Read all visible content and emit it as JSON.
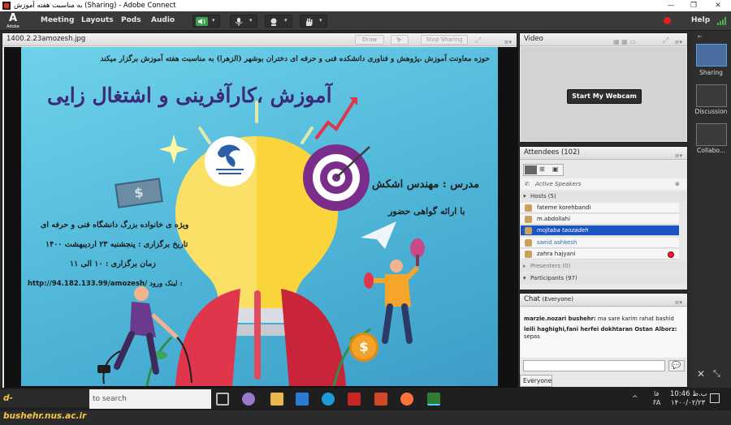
{
  "window": {
    "title": "به مناسبت هفته آموزش (Sharing) - Adobe Connect",
    "minimize": "—",
    "maximize": "❐",
    "close": "✕"
  },
  "menubar": {
    "logo_text": "Adobe",
    "items": [
      "Meeting",
      "Layouts",
      "Pods",
      "Audio"
    ],
    "help": "Help",
    "record_color": "#e02020"
  },
  "share_pod": {
    "title": "1400.2.23amozesh.jpg",
    "draw_label": "Draw",
    "stop_label": "Stop Sharing"
  },
  "slide": {
    "header": "حوزه معاونت آموزش ،پژوهش و فناوری دانشکده فنی و حرفه ای دختران بوشهر (الزهرا) به مناسبت هفته آموزش برگزار میکند",
    "main_title": "آموزش ،کارآفرینی و اشتغال زایی",
    "teacher": "مدرس : مهندس اشکش",
    "certificate": "با ارائه گواهی حضور",
    "audience": "ویژه ی خانواده بزرگ دانشگاه فنی و حرفه ای",
    "date": "تاریخ برگزاری : پنجشنبه ۲۳ اردیبهشت ۱۴۰۰",
    "time": "زمان برگزاری : ۱۰ الی ۱۱",
    "link_label": "لینک ورود :",
    "link": "http://94.182.133.99/amozesh/",
    "dollar": "$",
    "coin": "$"
  },
  "video_pod": {
    "title": "Video",
    "webcam_button": "Start My Webcam"
  },
  "attendees_pod": {
    "title": "Attendees",
    "count": "(102)",
    "active_speakers": "Active Speakers",
    "hosts_label": "Hosts (5)",
    "hosts": [
      "fateme korehbandi",
      "m.abdollahi",
      "mojtaba taozadeh",
      "saeid ashkesh",
      "zahra hajyani"
    ],
    "selected_host": "mojtaba taozadeh",
    "presenters_label": "Presenters (0)",
    "participants_label": "Participants (97)"
  },
  "chat_pod": {
    "title": "Chat",
    "scope": "(Everyone)",
    "messages": [
      {
        "sender": "marzie.nozari bushehr:",
        "text": "ma sare karim rahat bashid"
      },
      {
        "sender": "leili haghighi,fani herfei dokhtaran Ostan Alborz:",
        "text": "sepas"
      }
    ],
    "recipient": "Everyone",
    "send_icon": "speech-bubble-icon"
  },
  "layouts_bar": {
    "items": [
      "Sharing",
      "Discussion",
      "Collabo..."
    ]
  },
  "taskbar": {
    "watermark": "d-bushehr.nus.ac.ir",
    "search_label": "to search",
    "clock_time": "10:46 ب.ظ",
    "clock_date": "۱۴۰۰/۰۲/۲۳",
    "lang": "FA",
    "fa_label": "فا"
  }
}
